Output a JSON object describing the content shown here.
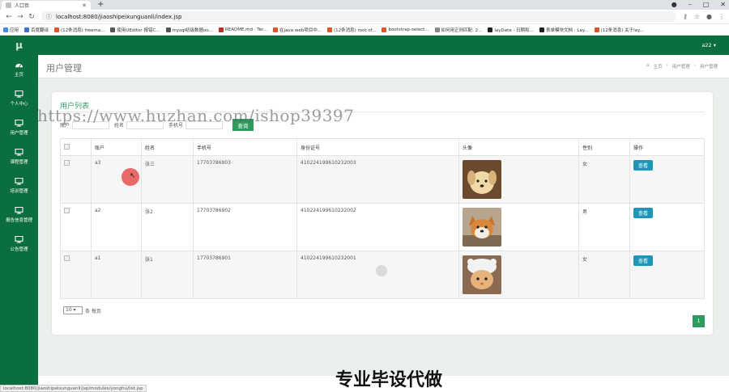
{
  "browser": {
    "tab_title": "人口页",
    "url": "localhost:8080/jiaoshipeixunguanli/index.jsp",
    "bookmarks": [
      {
        "label": "应用",
        "color": "#4a86e8"
      },
      {
        "label": "百度翻译",
        "color": "#3b6fd8"
      },
      {
        "label": "(12条消息) freema...",
        "color": "#e2522b"
      },
      {
        "label": "使用UEditor 报错C...",
        "color": "#555555"
      },
      {
        "label": "mysql初级数据oo...",
        "color": "#555555"
      },
      {
        "label": "README.md · Ter...",
        "color": "#c62a2a"
      },
      {
        "label": "在java web项目中...",
        "color": "#e2522b"
      },
      {
        "label": "(12条消息) root of...",
        "color": "#e2522b"
      },
      {
        "label": "bootstrap-select...",
        "color": "#e2522b"
      },
      {
        "label": "如何用正则匹配: 2...",
        "color": "#888888"
      },
      {
        "label": "layDate - 日期和...",
        "color": "#222222"
      },
      {
        "label": "表单模块文档 - Lay...",
        "color": "#222222"
      },
      {
        "label": "(12条消息) 关于lay...",
        "color": "#e2522b"
      }
    ]
  },
  "app": {
    "logo": "μ",
    "user": "a22 ▾",
    "accent": "#0b6e3f",
    "sidebar": [
      {
        "label": "主页"
      },
      {
        "label": "个人中心"
      },
      {
        "label": "用户管理"
      },
      {
        "label": "课程管理"
      },
      {
        "label": "培训管理"
      },
      {
        "label": "报告信息管理"
      },
      {
        "label": "公告管理"
      }
    ],
    "page_title": "用户管理",
    "breadcrumb": [
      "主页",
      "›",
      "用户管理",
      "›",
      "用户管理"
    ]
  },
  "panel": {
    "title": "用户列表",
    "search": {
      "fields": [
        {
          "label": "账户"
        },
        {
          "label": "姓名"
        },
        {
          "label": "手机号"
        }
      ],
      "button": "查询"
    },
    "columns": [
      "",
      "账户",
      "姓名",
      "手机号",
      "身份证号",
      "头像",
      "性别",
      "操作"
    ],
    "rows": [
      {
        "account": "a3",
        "name": "张三",
        "phone": "17703786903",
        "idcard": "410224199610232003",
        "avatar": "puppy",
        "gender": "女",
        "action": "查看"
      },
      {
        "account": "a2",
        "name": "张2",
        "phone": "17703786902",
        "idcard": "410224199610232002",
        "avatar": "shiba",
        "gender": "男",
        "action": "查看"
      },
      {
        "account": "a1",
        "name": "张1",
        "phone": "17703786901",
        "idcard": "410224199610232001",
        "avatar": "cat",
        "gender": "女",
        "action": "查看"
      }
    ],
    "page_size": "10",
    "page_size_suffix": "条 每页",
    "current_page": "1"
  },
  "overlay": {
    "watermark": "https://www.huzhan.com/ishop39397",
    "caption": "专业毕设代做",
    "status": "localhost:8080/jiaoshipeixunguanli/jsp/modules/yonghu/list.jsp"
  }
}
